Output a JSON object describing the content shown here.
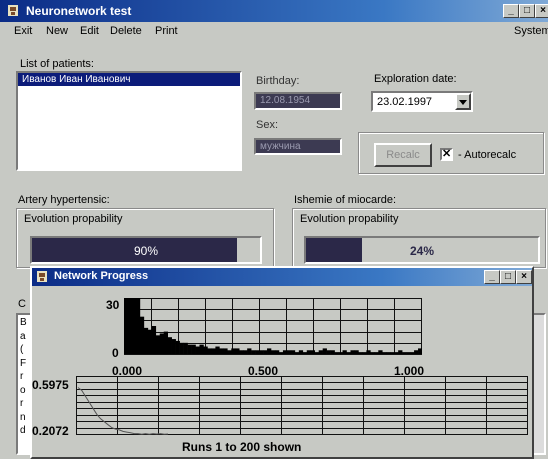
{
  "window": {
    "title": "Neuronetwork test"
  },
  "menu": {
    "exit": "Exit",
    "new": "New",
    "edit": "Edit",
    "delete": "Delete",
    "print": "Print",
    "system": "System"
  },
  "patients": {
    "label": "List of patients:",
    "items": [
      "Иванов Иван Иванович"
    ]
  },
  "birthday": {
    "label": "Birthday:",
    "value": "12.08.1954"
  },
  "sex": {
    "label": "Sex:",
    "value": "мужчина"
  },
  "exploration": {
    "label": "Exploration date:",
    "value": "23.02.1997"
  },
  "recalc": {
    "button": "Recalc",
    "checkbox_label": "- Autorecalc",
    "checked": true
  },
  "artery": {
    "label": "Artery hypertensic:",
    "sublabel": "Evolution propability",
    "percent": "90%",
    "fraction": 0.9
  },
  "ischemia": {
    "label": "Ishemie of miocarde:",
    "sublabel": "Evolution propability",
    "percent": "24%",
    "fraction": 0.24
  },
  "left_column_letters": [
    "B",
    "a",
    "(",
    "F",
    "r",
    "o",
    "r",
    "n",
    "d"
  ],
  "side_label": "C",
  "network": {
    "title": "Network Progress",
    "histogram": {
      "y_ticks": [
        "30",
        "0"
      ],
      "x_ticks": [
        "0.000",
        "0.500",
        "1.000"
      ],
      "values": [
        30,
        30,
        30,
        30,
        20,
        14,
        13,
        15,
        10,
        11,
        12,
        9,
        8,
        7,
        6,
        6,
        5,
        5,
        4,
        5,
        4,
        3,
        3,
        4,
        3,
        3,
        2,
        3,
        3,
        2,
        2,
        3,
        2,
        2,
        2,
        2,
        3,
        2,
        2,
        1,
        2,
        2,
        2,
        1,
        2,
        1,
        2,
        2,
        1,
        2,
        3,
        2,
        2,
        1,
        1,
        2,
        1,
        2,
        2,
        1,
        1,
        2,
        1,
        1,
        2,
        1,
        1,
        1,
        1,
        2,
        1,
        1,
        1,
        2,
        3
      ]
    },
    "error_plot": {
      "y_ticks": [
        "0.5975",
        "0.2072"
      ],
      "caption": "Runs 1 to 200 shown",
      "values": [
        0.52,
        0.5,
        0.46,
        0.42,
        0.38,
        0.34,
        0.31,
        0.29,
        0.27,
        0.25,
        0.24,
        0.235,
        0.225,
        0.22,
        0.215,
        0.21,
        0.21,
        0.205,
        0.21,
        0.205,
        0.21,
        0.207,
        0.21,
        0.205,
        0.207
      ]
    }
  }
}
